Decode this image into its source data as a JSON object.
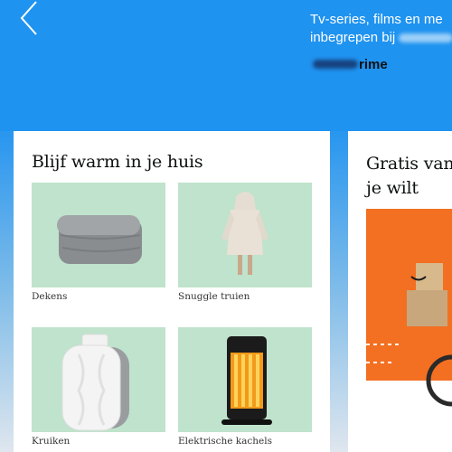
{
  "header": {
    "back_icon": "chevron-left-icon",
    "promo_line1": "Tv-series, films en me",
    "promo_line2": "inbegrepen bij",
    "prime_label": "rime",
    "background_color": "#1f93f0"
  },
  "left_card": {
    "title": "Blijf warm in je huis",
    "tile_background": "#bfe3cc",
    "items": [
      {
        "label": "Dekens",
        "icon": "blanket-image"
      },
      {
        "label": "Snuggle truien",
        "icon": "snuggle-hoodie-image"
      },
      {
        "label": "Kruiken",
        "icon": "hot-water-bottle-image"
      },
      {
        "label": "Elektrische kachels",
        "icon": "electric-heater-image"
      }
    ]
  },
  "right_card": {
    "title": "Gratis van je wilt",
    "title_line1": "Gratis van",
    "title_line2": "je wilt",
    "accent_color": "#f36f21"
  }
}
